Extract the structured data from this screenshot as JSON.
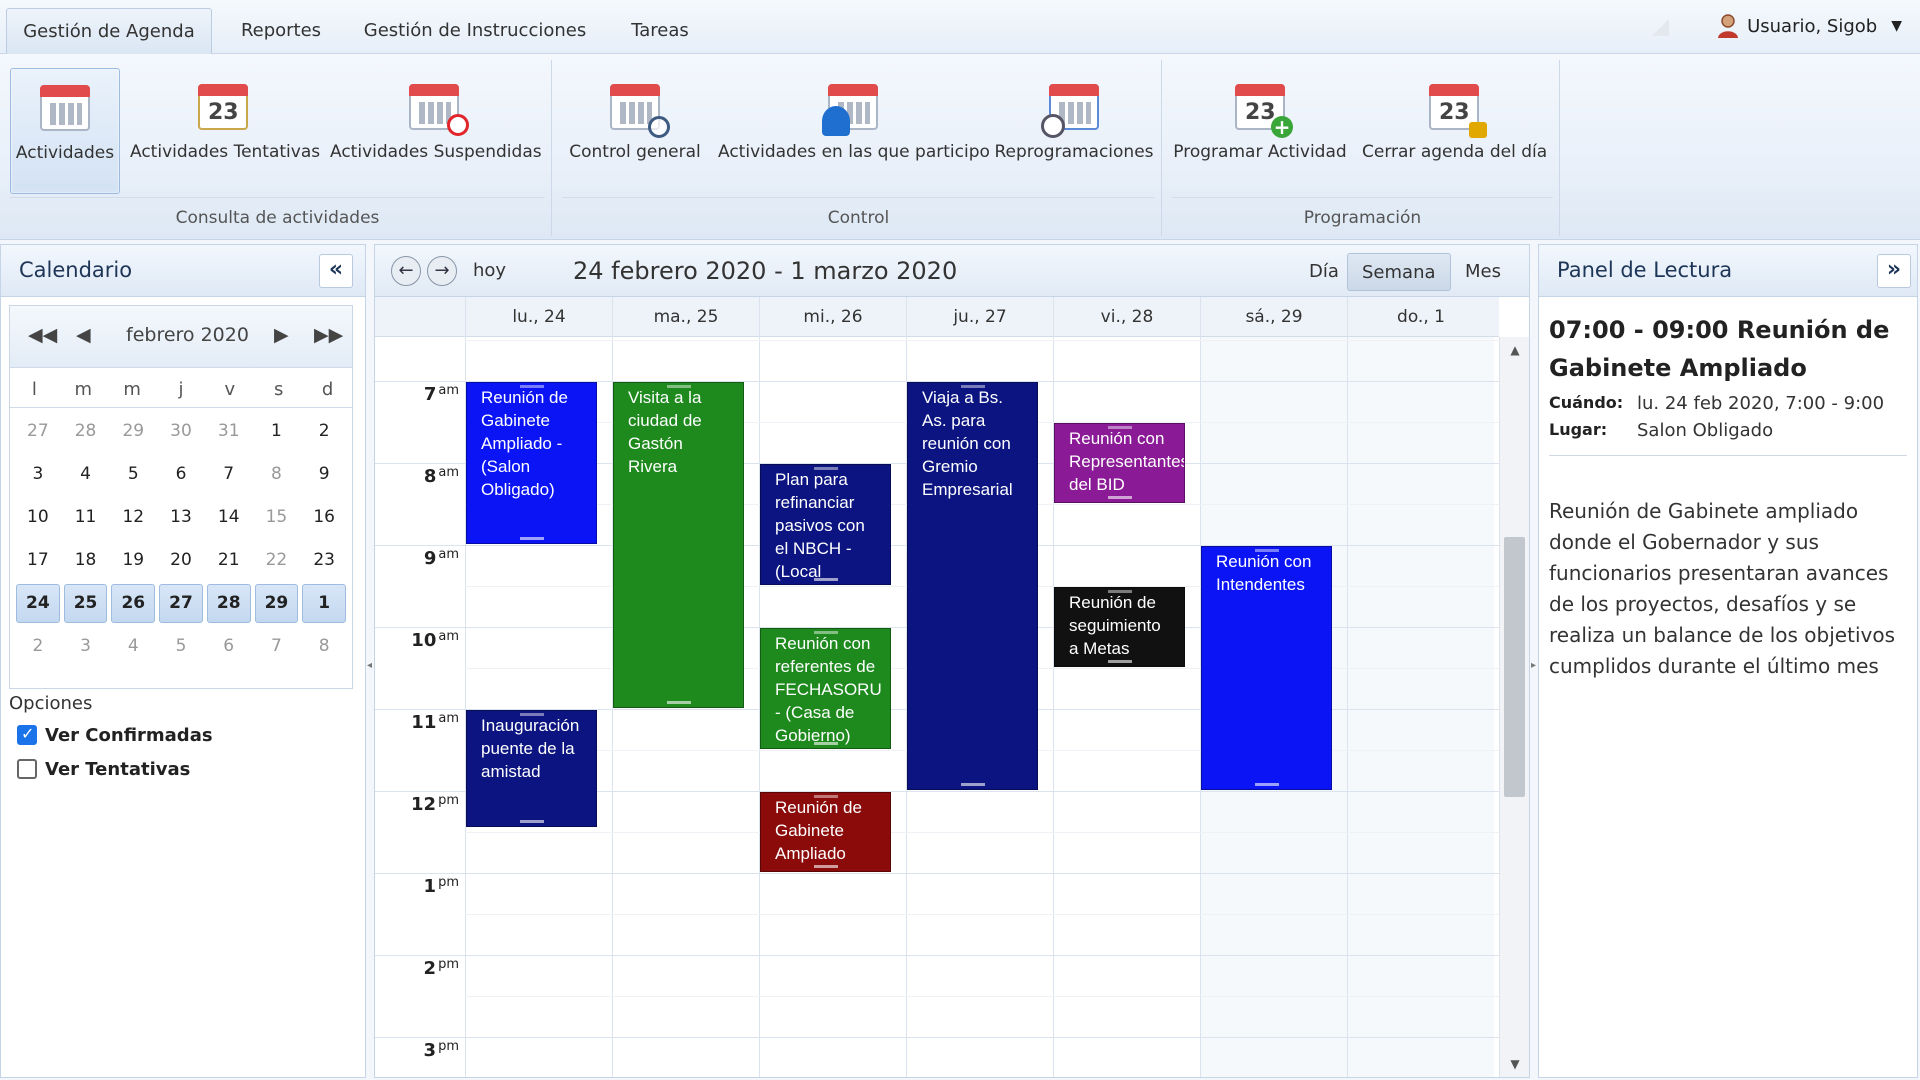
{
  "tabs": [
    {
      "label": "Gestión de Agenda"
    },
    {
      "label": "Reportes"
    },
    {
      "label": "Gestión de Instrucciones"
    },
    {
      "label": "Tareas"
    }
  ],
  "user": {
    "name": "Usuario, Sigob"
  },
  "ribbon": {
    "groups": [
      {
        "label": "Consulta de actividades",
        "buttons": [
          "Actividades",
          "Actividades Tentativas",
          "Actividades Suspendidas"
        ]
      },
      {
        "label": "Control",
        "buttons": [
          "Control general",
          "Actividades en las que participo",
          "Reprogramaciones"
        ]
      },
      {
        "label": "Programación",
        "buttons": [
          "Programar Actividad",
          "Cerrar agenda del día"
        ]
      }
    ],
    "icon_numbers": [
      "23",
      "23",
      "23"
    ]
  },
  "calendar_panel": {
    "title": "Calendario",
    "collapse_glyph": "«",
    "month": "febrero 2020",
    "dow": [
      "l",
      "m",
      "m",
      "j",
      "v",
      "s",
      "d"
    ],
    "days": [
      "27",
      "28",
      "29",
      "30",
      "31",
      "1",
      "2",
      "3",
      "4",
      "5",
      "6",
      "7",
      "8",
      "9",
      "10",
      "11",
      "12",
      "13",
      "14",
      "15",
      "16",
      "17",
      "18",
      "19",
      "20",
      "21",
      "22",
      "23",
      "24",
      "25",
      "26",
      "27",
      "28",
      "29",
      "1",
      "2",
      "3",
      "4",
      "5",
      "6",
      "7",
      "8"
    ],
    "options_title": "Opciones",
    "options": [
      {
        "label": "Ver Confirmadas",
        "checked": true
      },
      {
        "label": "Ver Tentativas",
        "checked": false
      }
    ]
  },
  "week_view": {
    "today_label": "hoy",
    "range": "24 febrero 2020 - 1 marzo 2020",
    "views": [
      "Día",
      "Semana",
      "Mes"
    ],
    "active_view": "Semana",
    "days": [
      "lu., 24",
      "ma., 25",
      "mi., 26",
      "ju., 27",
      "vi., 28",
      "sá., 29",
      "do., 1"
    ],
    "hours": [
      {
        "h": "7",
        "p": "am"
      },
      {
        "h": "8",
        "p": "am"
      },
      {
        "h": "9",
        "p": "am"
      },
      {
        "h": "10",
        "p": "am"
      },
      {
        "h": "11",
        "p": "am"
      },
      {
        "h": "12",
        "p": "pm"
      },
      {
        "h": "1",
        "p": "pm"
      },
      {
        "h": "2",
        "p": "pm"
      },
      {
        "h": "3",
        "p": "pm"
      }
    ],
    "events": [
      {
        "day": 0,
        "start": 7.0,
        "end": 9.0,
        "title": "Reunión de Gabinete Ampliado - (Salon Obligado)",
        "color": "#0a14f5"
      },
      {
        "day": 0,
        "start": 11.0,
        "end": 12.45,
        "title": "Inauguración puente de la amistad",
        "color": "#0b1480"
      },
      {
        "day": 1,
        "start": 7.0,
        "end": 11.0,
        "title": "Visita a la ciudad de Gastón Rivera",
        "color": "#1e8a1e"
      },
      {
        "day": 2,
        "start": 8.0,
        "end": 9.5,
        "title": "Plan para refinanciar pasivos con el NBCH - (Local",
        "color": "#0b1480"
      },
      {
        "day": 2,
        "start": 10.0,
        "end": 11.5,
        "title": "Reunión con referentes de FECHASORU - (Casa de Gobierno)",
        "color": "#1e8a1e"
      },
      {
        "day": 2,
        "start": 12.0,
        "end": 13.0,
        "title": "Reunión de Gabinete Ampliado",
        "color": "#8b0a0a"
      },
      {
        "day": 3,
        "start": 7.0,
        "end": 12.0,
        "title": "Viaja a Bs. As. para reunión con Gremio Empresarial",
        "color": "#0b1480"
      },
      {
        "day": 4,
        "start": 7.5,
        "end": 8.5,
        "title": "Reunión con Representantes del BID",
        "color": "#8a1a96"
      },
      {
        "day": 4,
        "start": 9.5,
        "end": 10.5,
        "title": "Reunión de seguimiento a Metas",
        "color": "#111111"
      },
      {
        "day": 5,
        "start": 9.0,
        "end": 12.0,
        "title": "Reunión con Intendentes",
        "color": "#0a14f5"
      }
    ]
  },
  "reading_panel": {
    "title": "Panel de Lectura",
    "collapse_glyph": "»",
    "event_title": "07:00 - 09:00 Reunión de Gabinete Ampliado",
    "when_label": "Cuándo:",
    "when_value": "lu. 24 feb 2020, 7:00 - 9:00",
    "where_label": "Lugar:",
    "where_value": "Salon Obligado",
    "description": "Reunión de Gabinete ampliado donde el Gobernador y sus funcionarios presentaran avances de los proyectos, desafíos y se realiza un balance de los objetivos cumplidos durante el último mes"
  }
}
